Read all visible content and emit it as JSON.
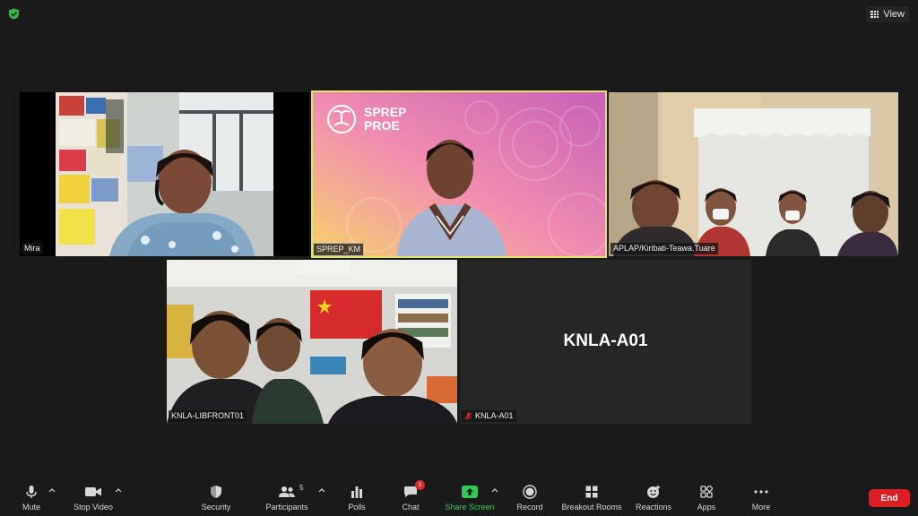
{
  "top_bar": {
    "view_label": "View",
    "security_icon": "shield-check-icon",
    "accent": "#3ab54a"
  },
  "participants": [
    {
      "name": "Mira",
      "active": false
    },
    {
      "name": "SPREP_KM",
      "active": true,
      "background_logo": "SPREP PROE"
    },
    {
      "name": "APLAP/Kiribati-Teawa.Tuare",
      "active": false
    },
    {
      "name": "KNLA-LIBFRONT01",
      "active": false
    },
    {
      "name": "KNLA-A01",
      "active": false,
      "video_off": true,
      "muted": true
    }
  ],
  "logo": {
    "line1": "SPREP",
    "line2": "PROE"
  },
  "toolbar": {
    "mute": "Mute",
    "stop_video": "Stop Video",
    "security": "Security",
    "participants": "Participants",
    "participants_count": "5",
    "polls": "Polls",
    "chat": "Chat",
    "chat_badge": "1",
    "share_screen": "Share Screen",
    "record": "Record",
    "breakout_rooms": "Breakout Rooms",
    "reactions": "Reactions",
    "apps": "Apps",
    "more": "More",
    "end": "End",
    "end_color": "#d91f24",
    "share_color": "#35c75a"
  }
}
